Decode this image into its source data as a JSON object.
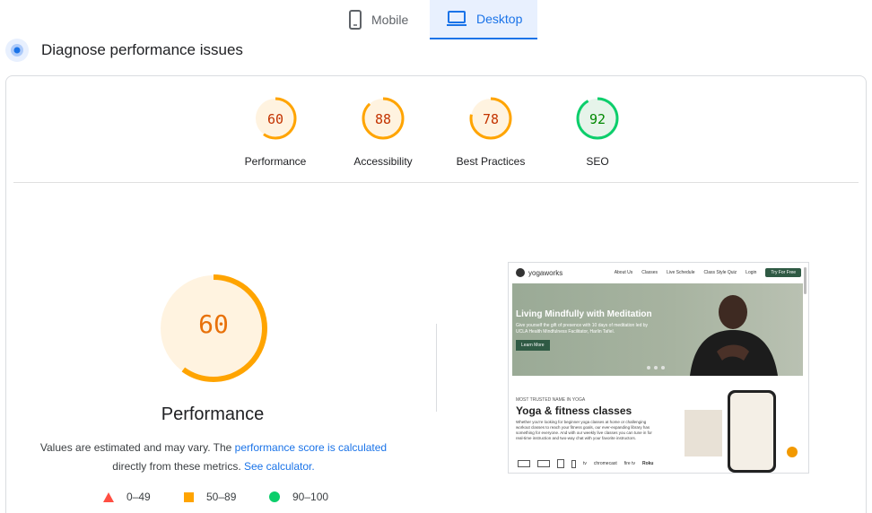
{
  "tabs": {
    "mobile": "Mobile",
    "desktop": "Desktop"
  },
  "header": {
    "title": "Diagnose performance issues"
  },
  "scores": [
    {
      "label": "Performance",
      "value": 60,
      "color": "#ffa400"
    },
    {
      "label": "Accessibility",
      "value": 88,
      "color": "#ffa400"
    },
    {
      "label": "Best Practices",
      "value": 78,
      "color": "#ffa400"
    },
    {
      "label": "SEO",
      "value": 92,
      "color": "#0cce6b"
    }
  ],
  "main_gauge": {
    "value": 60,
    "label": "Performance",
    "color": "#ffa400"
  },
  "note": {
    "prefix": "Values are estimated and may vary. The ",
    "link1": "performance score is calculated",
    "middle": "directly from these metrics. ",
    "link2": "See calculator."
  },
  "legend": [
    {
      "range": "0–49",
      "shape": "triangle",
      "color": "#ff4e42"
    },
    {
      "range": "50–89",
      "shape": "square",
      "color": "#ffa400"
    },
    {
      "range": "90–100",
      "shape": "circle",
      "color": "#0cce6b"
    }
  ],
  "screenshot": {
    "logo": "yogaworks",
    "nav_links": [
      "About Us",
      "Classes",
      "Live Schedule",
      "Class Style Quiz",
      "Login"
    ],
    "cta": "Try For Free",
    "hero_title": "Living Mindfully with Meditation",
    "hero_text": "Give yourself the gift of presence with 10 days of meditation led by UCLA Health Mindfulness Facilitator, Harlin Tafiel.",
    "learn_more": "Learn More",
    "kicker": "MOST TRUSTED NAME IN YOGA",
    "section_title": "Yoga & fitness classes",
    "section_body": "Whether you're looking for beginner yoga classes at home or challenging workout classes to reach your fitness goals, our ever-expanding library has something for everyone. And with our weekly live classes you can tune in for real-time instruction and two-way chat with your favorite instructors.",
    "devices": [
      "tv",
      "chromecast",
      "fire tv",
      "Roku"
    ]
  }
}
